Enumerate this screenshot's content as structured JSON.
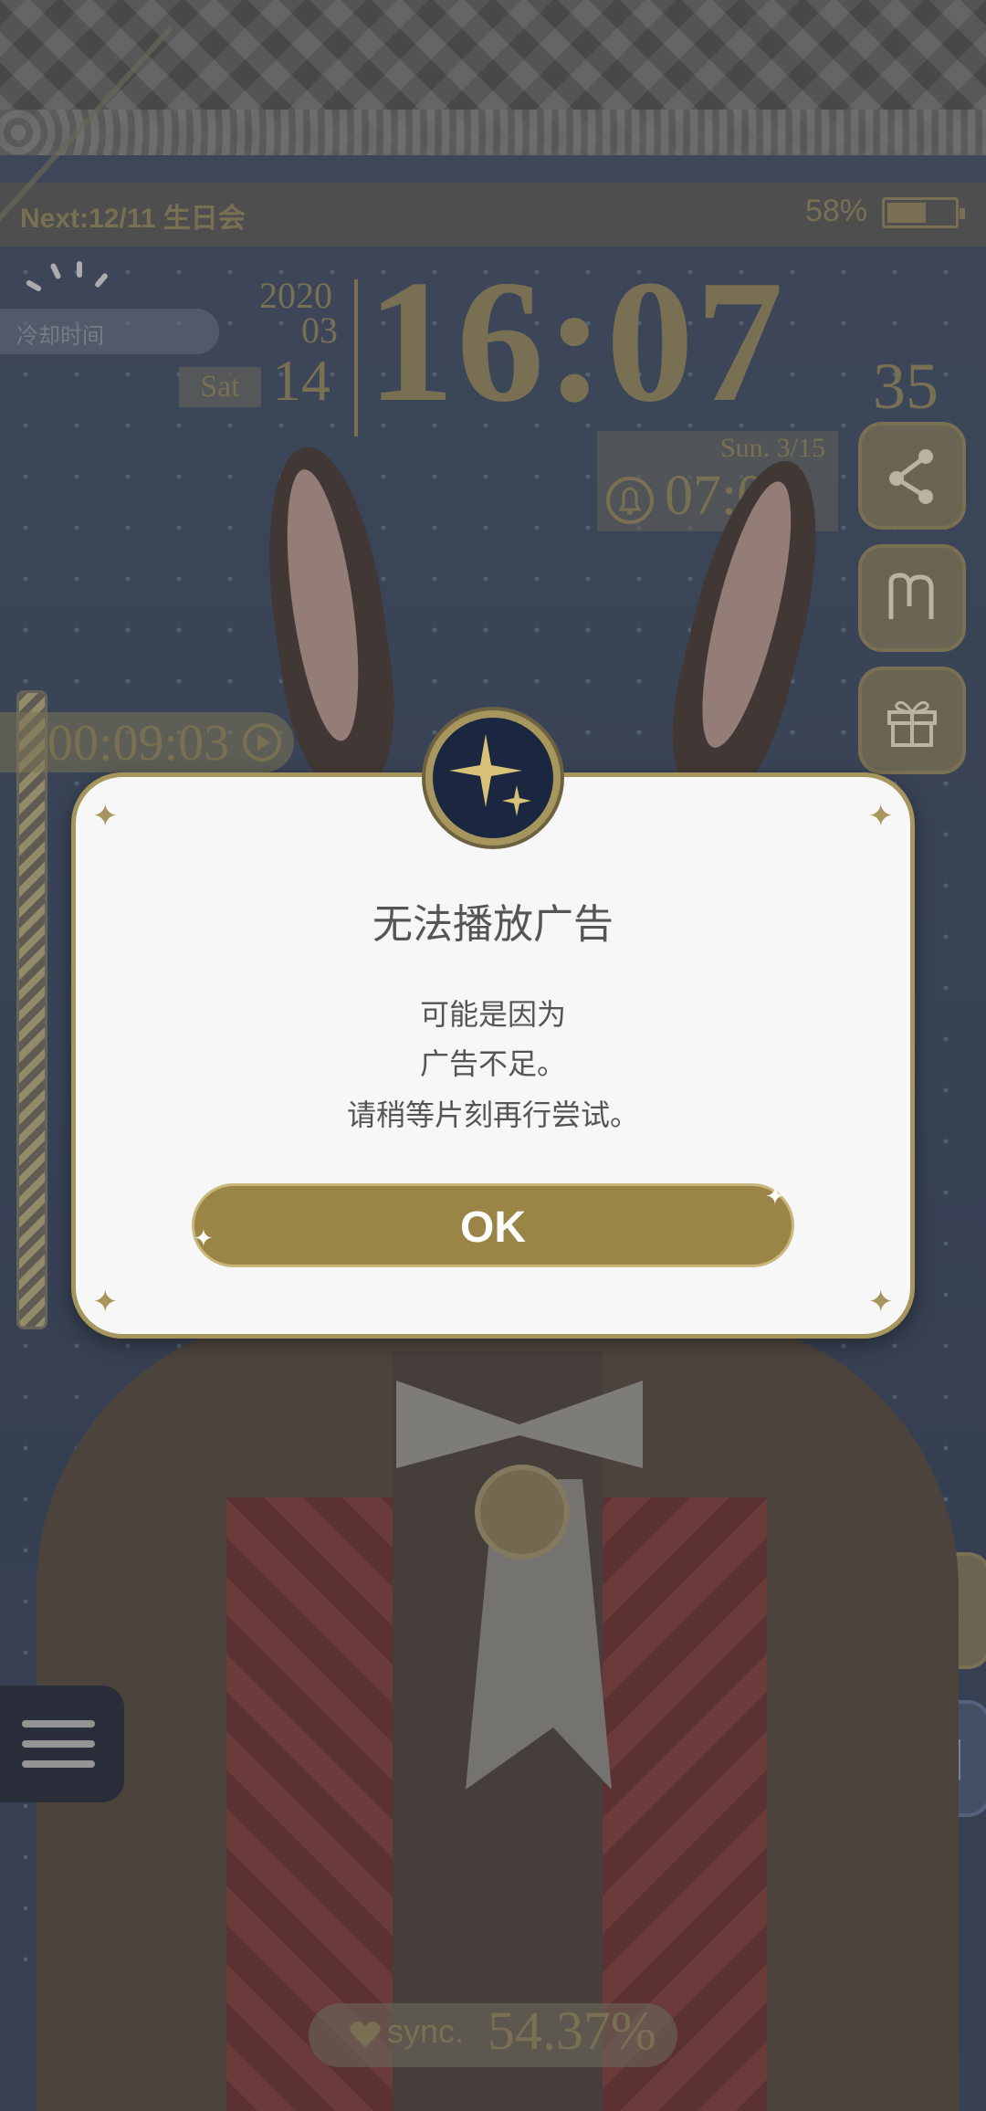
{
  "status": {
    "next_event": "Next:12/11 生日会",
    "battery_percent_text": "58%",
    "battery_level": 0.58
  },
  "clock": {
    "year": "2020",
    "month": "03",
    "day": "14",
    "weekday": "Sat",
    "time": "16:07",
    "seconds": "35",
    "cooldown_label": "冷却时间"
  },
  "alarm": {
    "day": "Sun.  3/15",
    "time": "07:00"
  },
  "timer": {
    "value": "00:09:03"
  },
  "sync": {
    "label": "sync.",
    "value": "54.37%"
  },
  "dialog": {
    "title": "无法播放广告",
    "lines": [
      "可能是因为",
      "广告不足。",
      "请稍等片刻再行尝试。"
    ],
    "ok_label": "OK"
  },
  "icons": {
    "side_buttons": [
      "share-icon",
      "memo-icon",
      "gift-icon",
      "moon-icon",
      "book-icon"
    ],
    "menu": "menu-icon"
  },
  "colors": {
    "accent_gold": "#958862",
    "dialog_button": "#9a8546",
    "dialog_bg": "#f7f7f7"
  }
}
